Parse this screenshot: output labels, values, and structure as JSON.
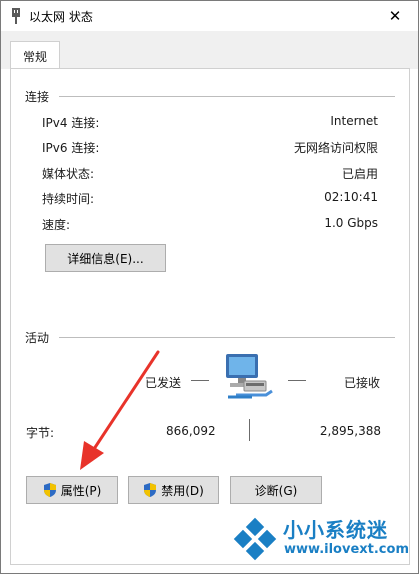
{
  "window": {
    "title": "以太网 状态",
    "close": "✕"
  },
  "tabs": [
    {
      "label": "常规"
    }
  ],
  "connection": {
    "label": "连接",
    "rows": [
      {
        "label": "IPv4 连接:",
        "value": "Internet"
      },
      {
        "label": "IPv6 连接:",
        "value": "无网络访问权限"
      },
      {
        "label": "媒体状态:",
        "value": "已启用"
      },
      {
        "label": "持续时间:",
        "value": "02:10:41"
      },
      {
        "label": "速度:",
        "value": "1.0 Gbps"
      }
    ],
    "details_button": "详细信息(E)..."
  },
  "activity": {
    "label": "活动",
    "sent_label": "已发送",
    "received_label": "已接收",
    "bytes_label": "字节:",
    "bytes_sent": "866,092",
    "bytes_received": "2,895,388"
  },
  "buttons": {
    "properties": "属性(P)",
    "disable": "禁用(D)",
    "diagnose": "诊断(G)"
  },
  "watermark": {
    "text": "小小系统迷",
    "url": "www.ilovext.com"
  },
  "colors": {
    "arrow": "#e8332a",
    "shield_blue": "#2d6bc4",
    "shield_yellow": "#f2c200",
    "watermark": "#1a7fc4"
  }
}
